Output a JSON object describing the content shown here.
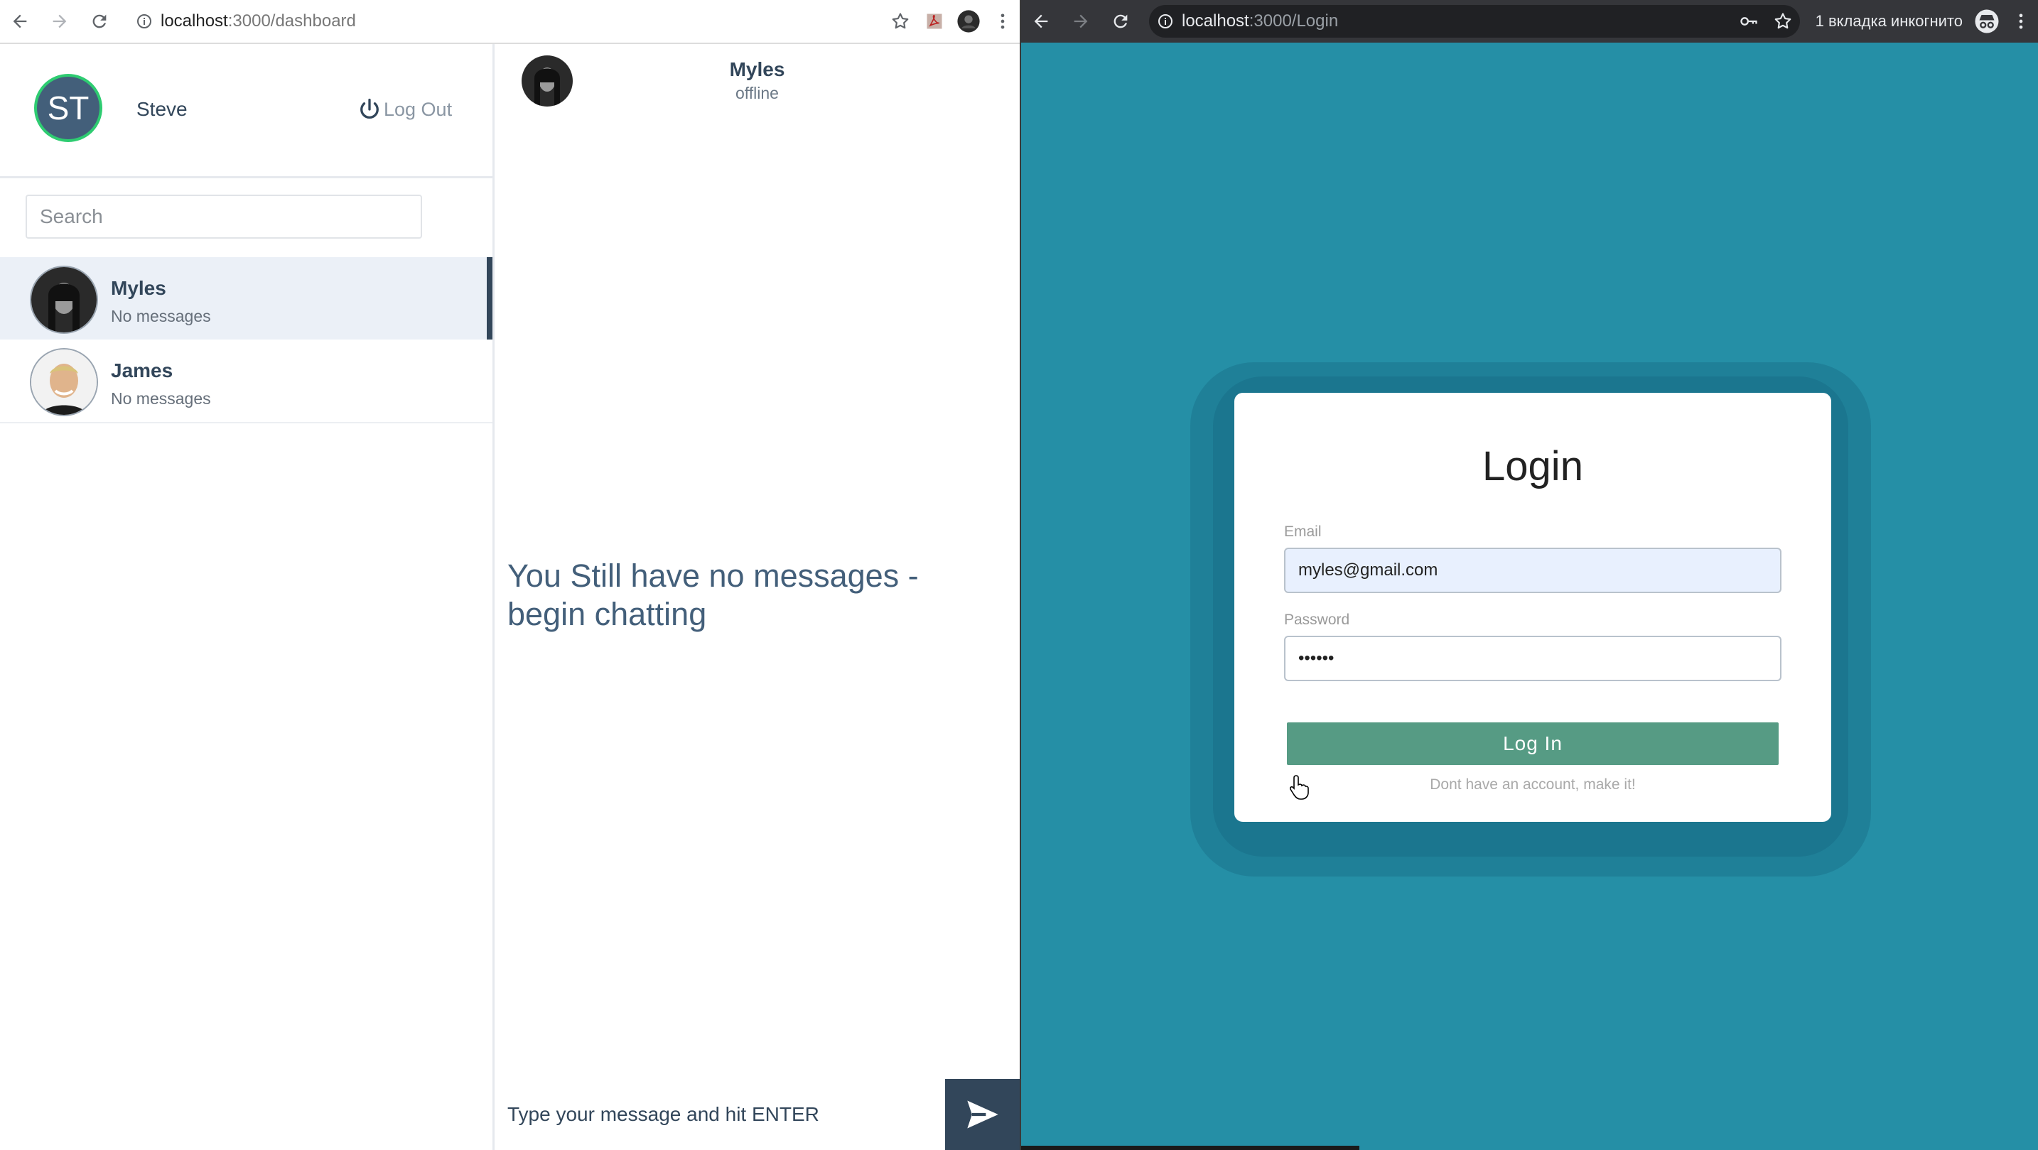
{
  "left_browser": {
    "url_host": "localhost",
    "url_path": ":3000/dashboard"
  },
  "right_browser": {
    "url_host": "localhost",
    "url_path": ":3000/Login",
    "incognito_label": "1 вкладка инкогнито"
  },
  "sidebar": {
    "profile": {
      "initials": "ST",
      "name": "Steve",
      "logout_label": "Log Out"
    },
    "search_placeholder": "Search",
    "contacts": [
      {
        "name": "Myles",
        "preview": "No messages",
        "active": true
      },
      {
        "name": "James",
        "preview": "No messages",
        "active": false
      }
    ]
  },
  "chat": {
    "contact_name": "Myles",
    "contact_status": "offline",
    "empty_message": "You Still have no messages - begin chatting",
    "input_placeholder": "Type your message and hit ENTER"
  },
  "login": {
    "title": "Login",
    "email_label": "Email",
    "email_value": "myles@gmail.com",
    "password_label": "Password",
    "password_value": "••••••",
    "button_label": "Log In",
    "signup_text": "Dont have an account, make it!"
  },
  "colors": {
    "primary": "#32465a",
    "login_bg": "#258fa6",
    "login_button": "#569b84",
    "online_ring": "#2ecc71"
  }
}
